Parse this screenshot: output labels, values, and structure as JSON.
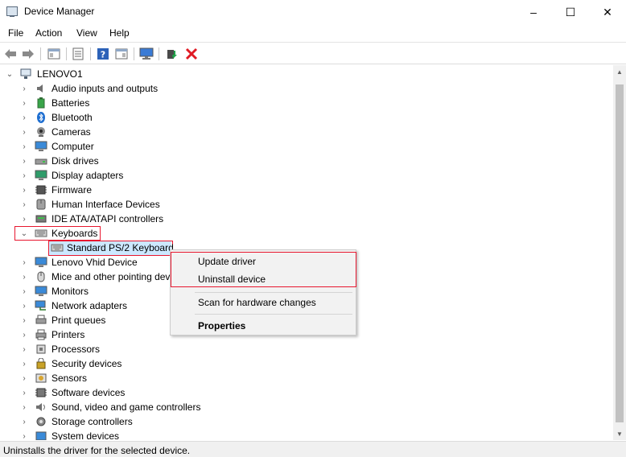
{
  "window": {
    "title": "Device Manager",
    "min_icon": "–",
    "max_icon": "☐",
    "close_icon": "✕"
  },
  "menu": {
    "items": [
      "File",
      "Action",
      "View",
      "Help"
    ]
  },
  "tree": {
    "root": "LENOVO1",
    "categories": [
      "Audio inputs and outputs",
      "Batteries",
      "Bluetooth",
      "Cameras",
      "Computer",
      "Disk drives",
      "Display adapters",
      "Firmware",
      "Human Interface Devices",
      "IDE ATA/ATAPI controllers",
      "Keyboards",
      "Lenovo Vhid Device",
      "Mice and other pointing devices",
      "Monitors",
      "Network adapters",
      "Print queues",
      "Printers",
      "Processors",
      "Security devices",
      "Sensors",
      "Software devices",
      "Sound, video and game controllers",
      "Storage controllers",
      "System devices"
    ],
    "expanded_child": "Standard PS/2 Keyboard"
  },
  "context_menu": {
    "update": "Update driver",
    "uninstall": "Uninstall device",
    "scan": "Scan for hardware changes",
    "properties": "Properties"
  },
  "status": {
    "text": "Uninstalls the driver for the selected device."
  },
  "colors": {
    "highlight_red": "#e8172f",
    "selection": "#cce8ff",
    "menu_bg": "#f2f2f2"
  }
}
